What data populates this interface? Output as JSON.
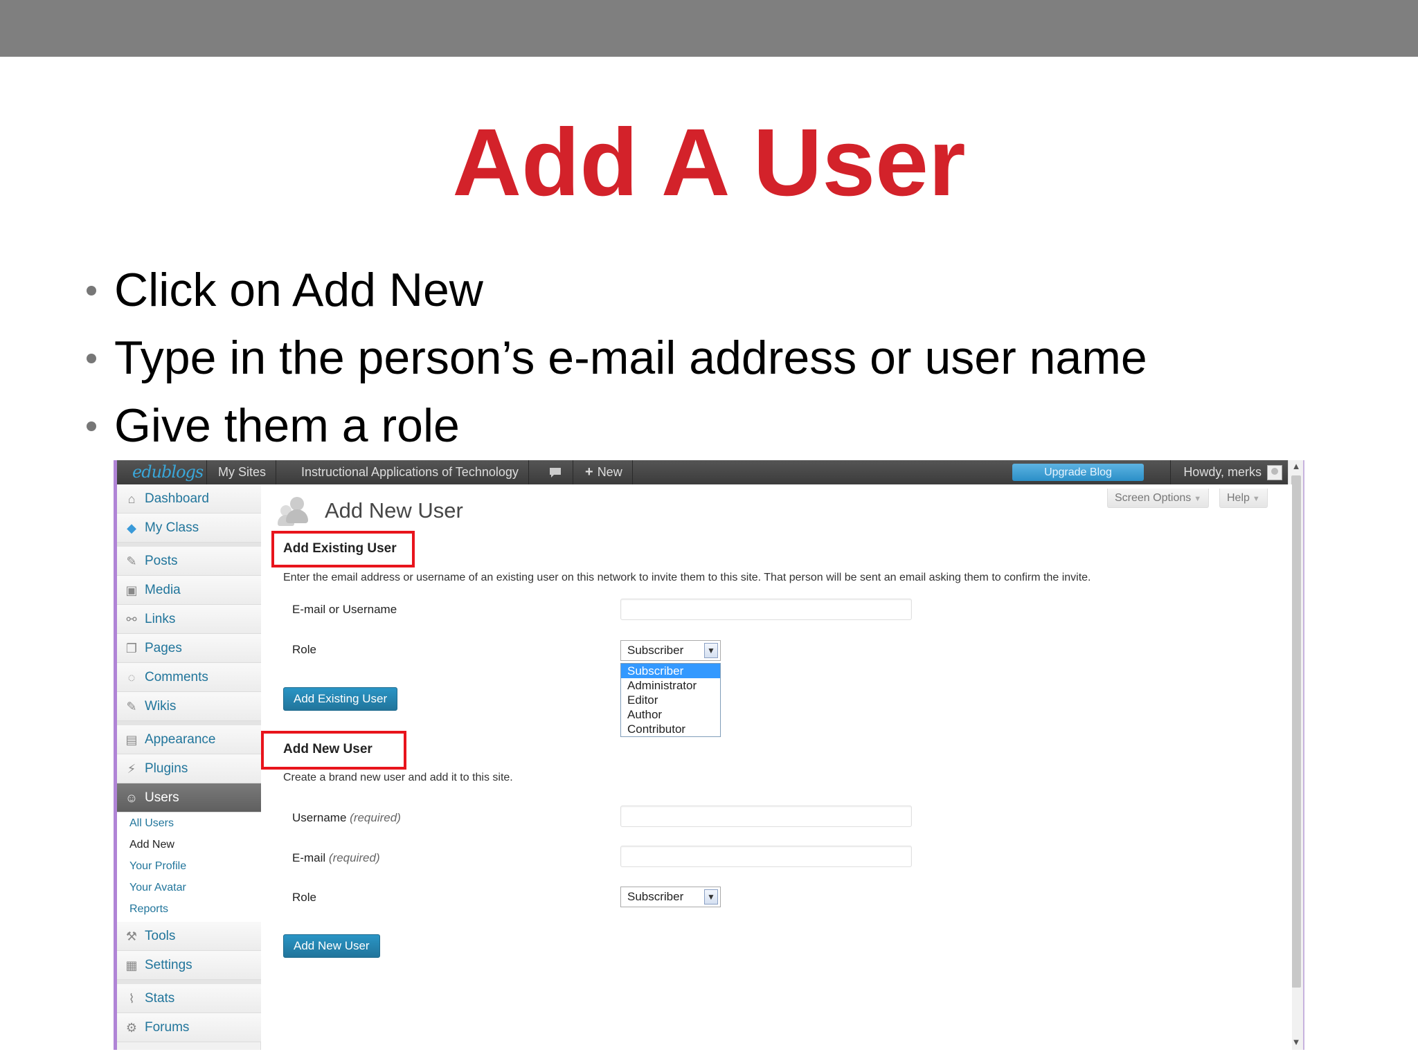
{
  "slide": {
    "title": "Add A User",
    "bullets": [
      "Click on Add New",
      "Type in the person’s e-mail address or user name",
      "Give them a role"
    ]
  },
  "adminbar": {
    "logo": "edublogs",
    "my_sites": "My Sites",
    "site_name": "Instructional Applications of Technology",
    "new_label": "New",
    "upgrade": "Upgrade Blog",
    "howdy": "Howdy, merks"
  },
  "sidebar": {
    "items": [
      {
        "label": "Dashboard",
        "icon": "⌂"
      },
      {
        "label": "My Class",
        "icon": "◆"
      },
      {
        "label": "Posts",
        "icon": "✎"
      },
      {
        "label": "Media",
        "icon": "▣"
      },
      {
        "label": "Links",
        "icon": "⚯"
      },
      {
        "label": "Pages",
        "icon": "❐"
      },
      {
        "label": "Comments",
        "icon": "◌"
      },
      {
        "label": "Wikis",
        "icon": "✎"
      },
      {
        "label": "Appearance",
        "icon": "▤"
      },
      {
        "label": "Plugins",
        "icon": "⚡"
      },
      {
        "label": "Users",
        "icon": "☺"
      },
      {
        "label": "Tools",
        "icon": "⚒"
      },
      {
        "label": "Settings",
        "icon": "▦"
      },
      {
        "label": "Stats",
        "icon": "⌇"
      },
      {
        "label": "Forums",
        "icon": "⚙"
      }
    ],
    "users_submenu": [
      "All Users",
      "Add New",
      "Your Profile",
      "Your Avatar",
      "Reports"
    ]
  },
  "main": {
    "heading": "Add New User",
    "screen_options": "Screen Options",
    "help": "Help",
    "existing": {
      "title": "Add Existing User",
      "description": "Enter the email address or username of an existing user on this network to invite them to this site. That person will be sent an email asking them to confirm the invite.",
      "email_label": "E-mail or Username",
      "role_label": "Role",
      "role_value": "Subscriber",
      "role_options": [
        "Subscriber",
        "Administrator",
        "Editor",
        "Author",
        "Contributor"
      ],
      "button": "Add Existing User"
    },
    "new_user": {
      "title": "Add New User",
      "description": "Create a brand new user and add it to this site.",
      "username_label": "Username",
      "email_label": "E-mail",
      "required": "(required)",
      "role_label": "Role",
      "role_value": "Subscriber",
      "button": "Add New User"
    }
  },
  "colors": {
    "title_red": "#d3222a",
    "highlight_red": "#e8141c",
    "link_blue": "#21759b",
    "top_band": "#7f7f7f"
  }
}
